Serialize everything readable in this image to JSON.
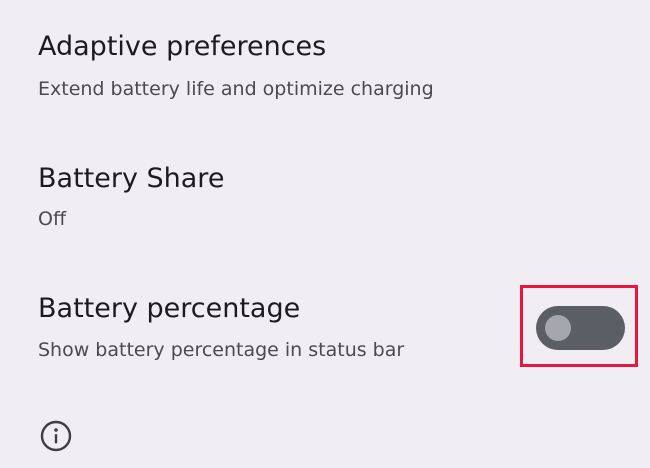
{
  "settings": {
    "adaptive": {
      "title": "Adaptive preferences",
      "subtitle": "Extend battery life and optimize charging"
    },
    "battery_share": {
      "title": "Battery Share",
      "subtitle": "Off"
    },
    "battery_percentage": {
      "title": "Battery percentage",
      "subtitle": "Show battery percentage in status bar",
      "toggle_state": "off"
    }
  },
  "icons": {
    "info": "info-icon"
  },
  "colors": {
    "background": "#F1EEF3",
    "toggle_track_off": "#5C5E65",
    "toggle_thumb_off": "#A6A6AE",
    "highlight": "#E8173F"
  }
}
